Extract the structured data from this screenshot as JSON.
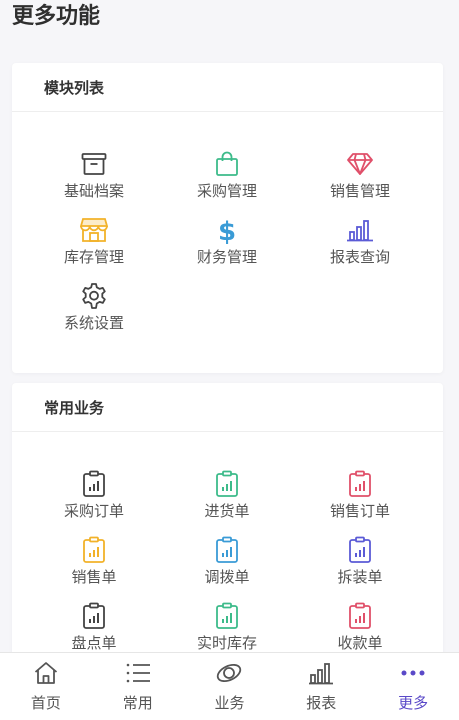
{
  "page": {
    "title": "更多功能"
  },
  "sections": [
    {
      "title": "模块列表",
      "items": [
        {
          "label": "基础档案",
          "icon": "archive-box-icon",
          "color": "#444444"
        },
        {
          "label": "采购管理",
          "icon": "shopping-bag-icon",
          "color": "#3dbb8a"
        },
        {
          "label": "销售管理",
          "icon": "diamond-icon",
          "color": "#e0506a"
        },
        {
          "label": "库存管理",
          "icon": "store-icon",
          "color": "#f2b22a"
        },
        {
          "label": "财务管理",
          "icon": "dollar-icon",
          "color": "#3a9bd6"
        },
        {
          "label": "报表查询",
          "icon": "bar-chart-icon",
          "color": "#5b5bd6"
        },
        {
          "label": "系统设置",
          "icon": "gear-icon",
          "color": "#444444"
        }
      ]
    },
    {
      "title": "常用业务",
      "items": [
        {
          "label": "采购订单",
          "icon": "clipboard-chart-icon",
          "color": "#444444"
        },
        {
          "label": "进货单",
          "icon": "clipboard-chart-icon",
          "color": "#3dbb8a"
        },
        {
          "label": "销售订单",
          "icon": "clipboard-chart-icon",
          "color": "#e0506a"
        },
        {
          "label": "销售单",
          "icon": "clipboard-chart-icon",
          "color": "#f2b22a"
        },
        {
          "label": "调拨单",
          "icon": "clipboard-chart-icon",
          "color": "#3a9bd6"
        },
        {
          "label": "拆装单",
          "icon": "clipboard-chart-icon",
          "color": "#5b5bd6"
        },
        {
          "label": "盘点单",
          "icon": "clipboard-chart-icon",
          "color": "#444444"
        },
        {
          "label": "实时库存",
          "icon": "clipboard-chart-icon",
          "color": "#3dbb8a"
        },
        {
          "label": "收款单",
          "icon": "clipboard-chart-icon",
          "color": "#e0506a"
        }
      ]
    }
  ],
  "tabbar": {
    "items": [
      {
        "label": "首页",
        "icon": "home-icon",
        "active": false
      },
      {
        "label": "常用",
        "icon": "list-icon",
        "active": false
      },
      {
        "label": "业务",
        "icon": "orbit-icon",
        "active": false
      },
      {
        "label": "报表",
        "icon": "bar-chart-icon",
        "active": false
      },
      {
        "label": "更多",
        "icon": "more-dots-icon",
        "active": true
      }
    ],
    "active_color": "#5a49c8",
    "inactive_color": "#555555"
  }
}
